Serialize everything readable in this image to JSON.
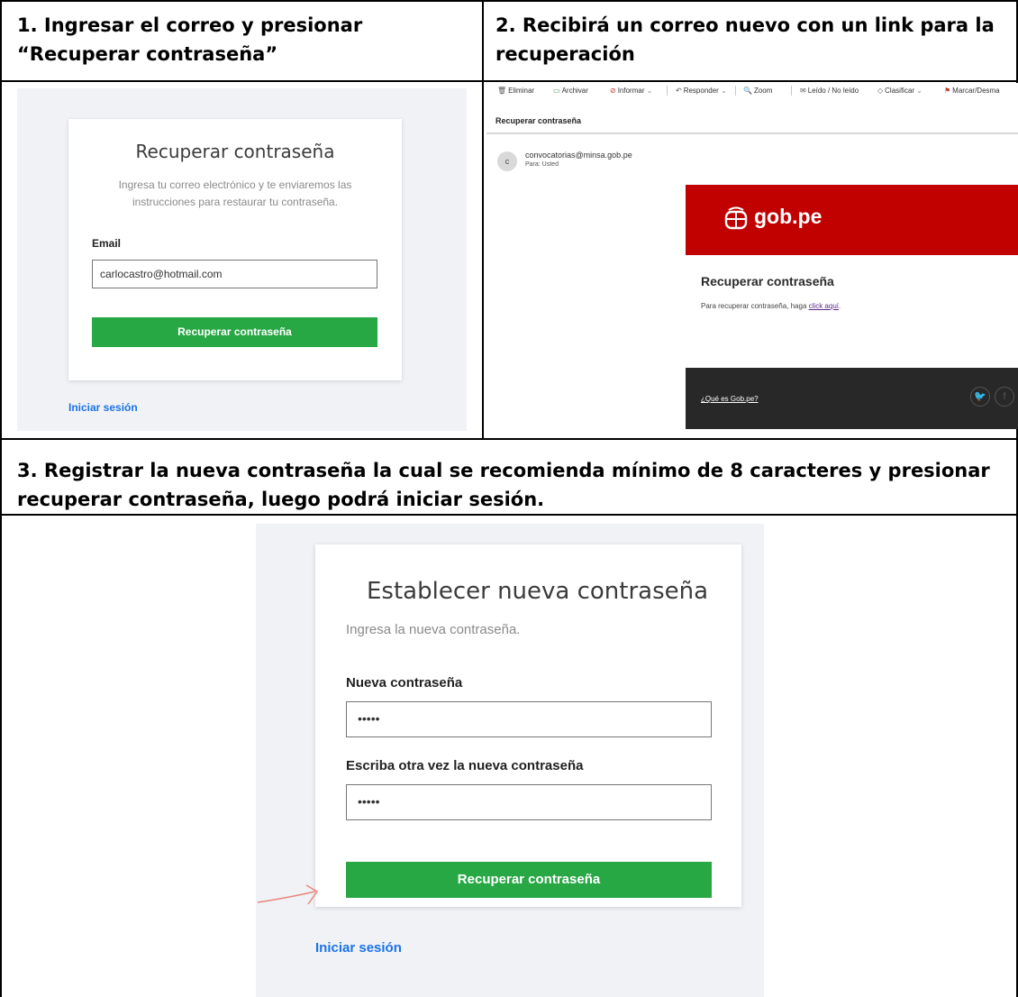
{
  "steps": [
    {
      "title_line1": "1. Ingresar el correo y presionar",
      "title_line2": "“Recuperar contraseña”"
    },
    {
      "title_line1": "2. Recibirá un correo nuevo con un link para la",
      "title_line2": "recuperación"
    },
    {
      "title_line1": "3. Registrar la nueva contraseña la cual se recomienda mínimo de 8 caracteres y presionar",
      "title_line2": "recuperar contraseña, luego podrá iniciar sesión."
    }
  ],
  "panel1": {
    "title": "Recuperar contraseña",
    "description": "Ingresa tu correo electrónico y te enviaremos las instrucciones para restaurar tu contraseña.",
    "email_label": "Email",
    "email_value": "carlocastro@hotmail.com",
    "button": "Recuperar contraseña",
    "login_link": "Iniciar sesión"
  },
  "panel2": {
    "toolbar": {
      "eliminar": "Eliminar",
      "archivar": "Archivar",
      "informar": "Informar",
      "responder": "Responder",
      "zoom": "Zoom",
      "leido": "Leído / No leído",
      "clasificar": "Clasificar",
      "marcar": "Marcar/Desma"
    },
    "subject": "Recuperar contraseña",
    "avatar_letter": "c",
    "sender": "convocatorias@minsa.gob.pe",
    "to": "Para:  Usted",
    "brand": "gob.pe",
    "mail_title": "Recuperar contraseña",
    "mail_text": "Para recuperar contraseña, haga ",
    "mail_link": "click aquí",
    "mail_text_end": ".",
    "footer_link": "¿Qué es Gob.pe?",
    "accent_red": "#c10000",
    "footer_bg": "#282828"
  },
  "panel3": {
    "title": "Establecer nueva contraseña",
    "description": "Ingresa la nueva contraseña.",
    "new_password_label": "Nueva contraseña",
    "new_password_value": "•••••",
    "repeat_password_label": "Escriba otra vez la nueva contraseña",
    "repeat_password_value": "•••••",
    "button": "Recuperar contraseña",
    "login_link": "Iniciar sesión"
  },
  "colors": {
    "button_green": "#28a745",
    "link_blue": "#1a73e8",
    "background_gray": "#f1f2f6",
    "arrow": "#e8877e"
  }
}
